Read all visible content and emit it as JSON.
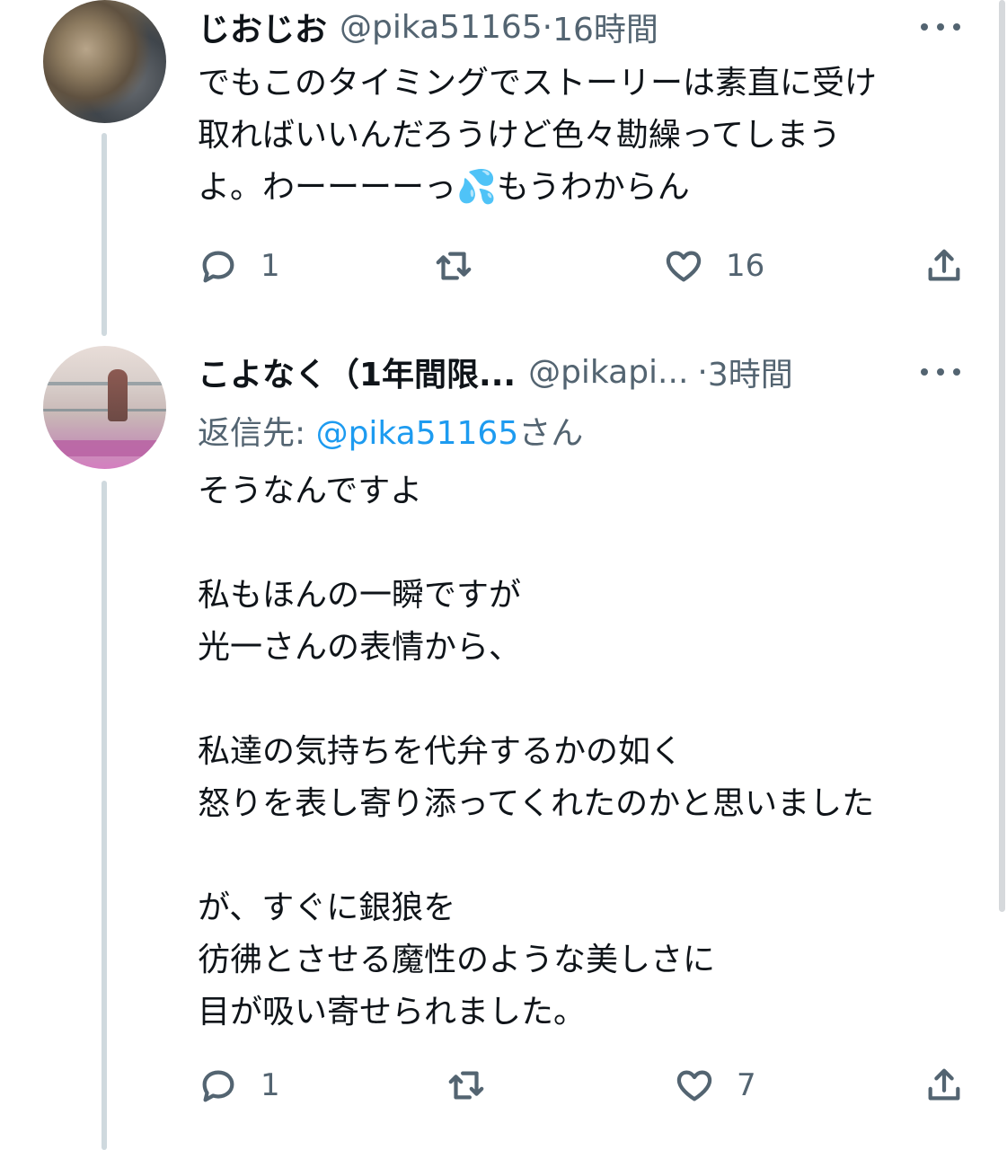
{
  "tweets": [
    {
      "display_name": "じおじお",
      "handle": "@pika51165",
      "separator": " · ",
      "time": "16時間",
      "body": "でもこのタイミングでストーリーは素直に受け\n取ればいいんだろうけど色々勘繰ってしまう\nよ。わーーーーっ💦もうわからん",
      "reply_count": "1",
      "like_count": "16"
    },
    {
      "display_name": "こよなく（1年間限...",
      "handle": "@pikapi...",
      "separator": " · ",
      "time": "3時間",
      "reply_to_label": "返信先: ",
      "reply_to_handle": "@pika51165",
      "reply_to_suffix": "さん",
      "body": "そうなんですよ\n\n私もほんの一瞬ですが\n光一さんの表情から、\n\n私達の気持ちを代弁するかの如く\n怒りを表し寄り添ってくれたのかと思いました\n\nが、すぐに銀狼を\n彷彿とさせる魔性のような美しさに\n目が吸い寄せられました。",
      "reply_count": "1",
      "like_count": "7"
    }
  ],
  "icons": {
    "reply": "reply-icon",
    "retweet": "retweet-icon",
    "like": "heart-icon",
    "share": "share-icon",
    "more": "more-icon"
  },
  "colors": {
    "text": "#0f1419",
    "secondary": "#536471",
    "link": "#1d9bf0",
    "thread_line": "#cfd9de"
  }
}
